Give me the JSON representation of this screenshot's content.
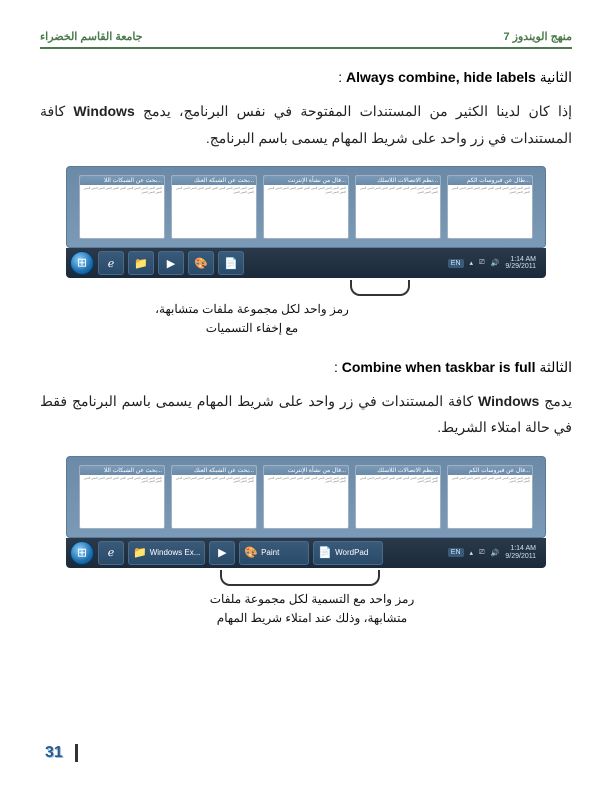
{
  "header": {
    "right": "منهج الويندوز 7",
    "left": "جامعة القاسم الخضراء"
  },
  "section1": {
    "prefix": "الثانية",
    "bold": "Always combine, hide labels",
    "colon": " :",
    "body_pre": "إذا كان لدينا الكثير من المستندات المفتوحة في نفس البرنامج، يدمج ",
    "inline": "Windows",
    "body_post": " كافة المستندات في زر واحد على شريط المهام يسمى باسم البرنامج."
  },
  "figure1": {
    "thumbs": [
      "...طال عن فيروسات الكم",
      "...نظم الاتصالات اللاسلك",
      "...قال من نشأة الإنترنت",
      "...بحث عن الشبكة العنك",
      "...بحث عن الشبكات اللا"
    ],
    "thumb_body": "النص النص النص النص النص النص النص النص النص النص النص النص النص النص",
    "taskbar": {
      "lang": "EN",
      "time": "1:14 AM",
      "date": "9/29/2011"
    },
    "callout": "رمز واحد لكل مجموعة ملفات متشابهة، مع إخفاء التسميات"
  },
  "section2": {
    "prefix": "الثالثة",
    "bold": "Combine when taskbar is full",
    "colon": ":",
    "body_pre": "يدمج ",
    "inline": "Windows",
    "body_post": " كافة المستندات في زر واحد على شريط المهام يسمى باسم البرنامج فقط في حالة امتلاء الشريط."
  },
  "figure2": {
    "thumbs": [
      "...قال عن فيروسات الكم",
      "...نظم الاتصالات اللاسلك",
      "...قال من نشأة الإنترنت",
      "...بحث عن الشبكة العنك",
      "...بحث عن الشبكات اللا"
    ],
    "thumb_body": "النص النص النص النص النص النص النص النص النص النص النص النص النص النص",
    "taskbar": {
      "labels": [
        "Windows Ex...",
        "Paint",
        "WordPad"
      ],
      "lang": "EN",
      "time": "1:14 AM",
      "date": "9/29/2011"
    },
    "callout": "رمز واحد مع التسمية لكل مجموعة ملفات متشابهة، وذلك عند امتلاء شريط المهام"
  },
  "page_number": "31"
}
